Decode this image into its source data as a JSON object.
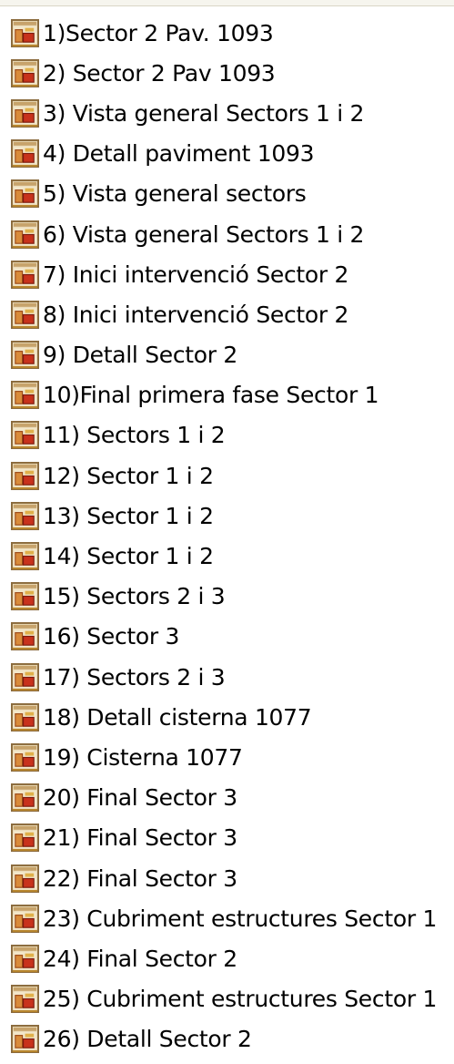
{
  "file_icon": "presentation-file-icon",
  "colors": {
    "icon_body": "#d98b3a",
    "icon_accent": "#c8321c",
    "text": "#000000"
  },
  "files": [
    {
      "label": "1)Sector 2 Pav. 1093"
    },
    {
      "label": "2) Sector 2 Pav 1093"
    },
    {
      "label": "3) Vista general Sectors 1 i 2"
    },
    {
      "label": "4) Detall paviment 1093"
    },
    {
      "label": "5) Vista general sectors"
    },
    {
      "label": "6) Vista general Sectors 1 i 2"
    },
    {
      "label": "7) Inici intervenció Sector 2"
    },
    {
      "label": "8) Inici intervenció Sector 2"
    },
    {
      "label": "9) Detall Sector 2"
    },
    {
      "label": "10)Final primera fase Sector 1"
    },
    {
      "label": "11) Sectors 1 i 2"
    },
    {
      "label": "12) Sector 1 i 2"
    },
    {
      "label": "13) Sector 1 i 2"
    },
    {
      "label": "14) Sector 1 i 2"
    },
    {
      "label": "15) Sectors 2 i 3"
    },
    {
      "label": "16) Sector 3"
    },
    {
      "label": "17) Sectors 2 i 3"
    },
    {
      "label": "18) Detall cisterna 1077"
    },
    {
      "label": "19) Cisterna 1077"
    },
    {
      "label": "20) Final Sector 3"
    },
    {
      "label": "21) Final Sector 3"
    },
    {
      "label": "22) Final Sector 3"
    },
    {
      "label": "23) Cubriment estructures Sector 1"
    },
    {
      "label": "24) Final Sector 2"
    },
    {
      "label": "25) Cubriment estructures Sector 1"
    },
    {
      "label": "26) Detall Sector 2"
    }
  ]
}
